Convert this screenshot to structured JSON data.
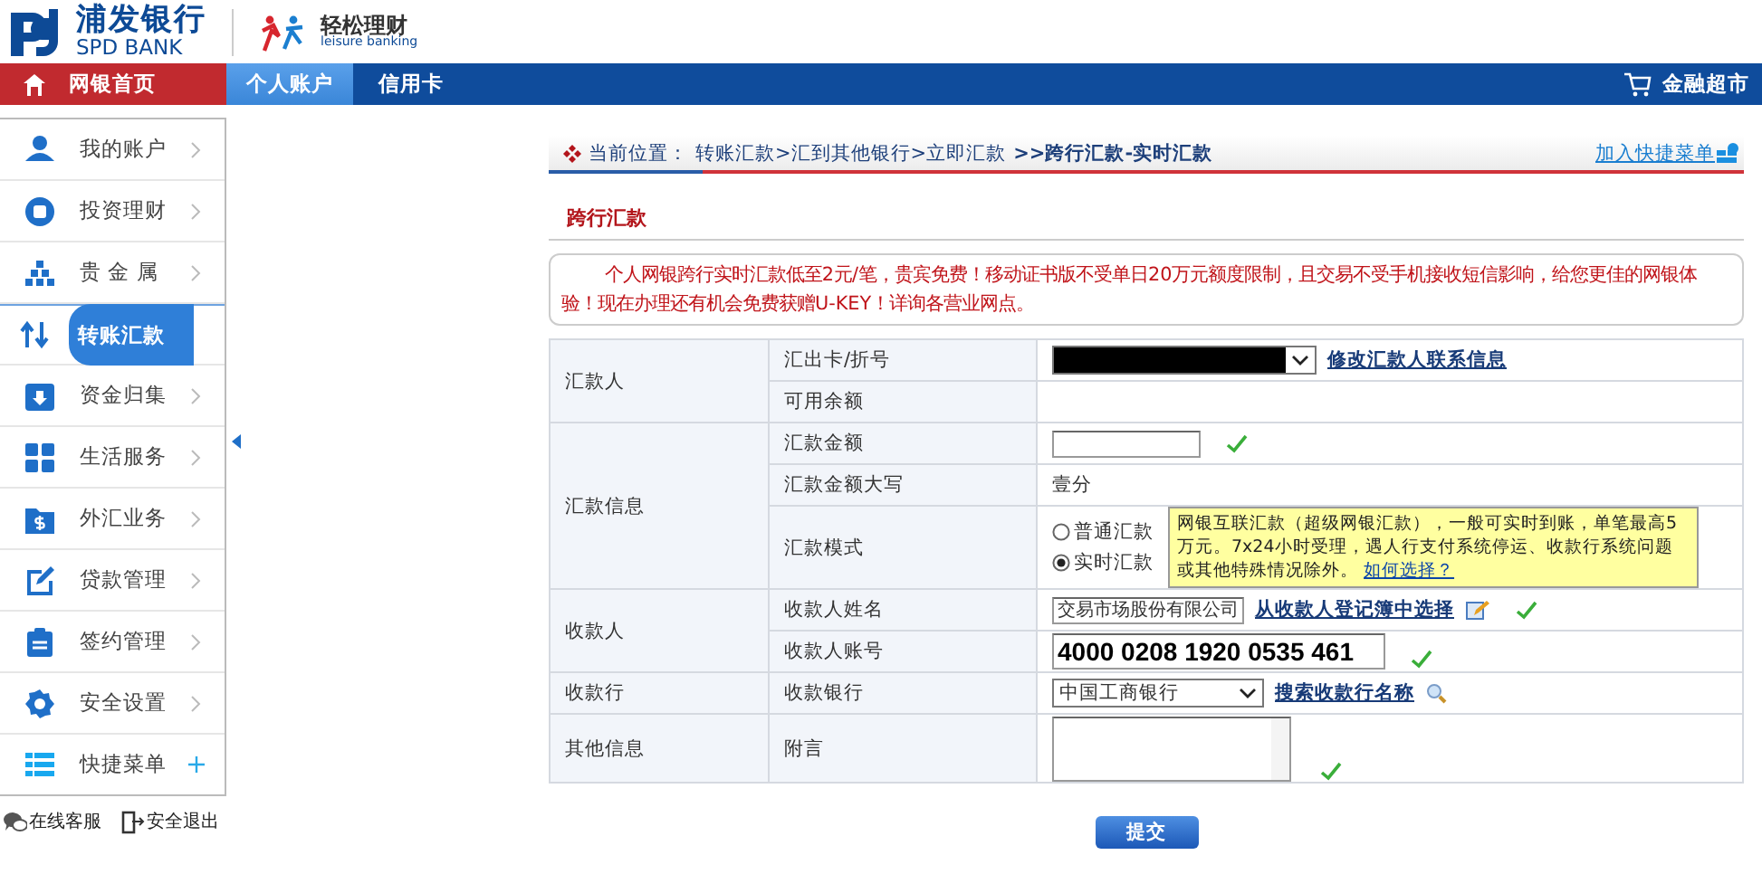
{
  "header": {
    "bank_name": "浦发银行",
    "bank_name_en": "SPD BANK",
    "brand": "轻松理财",
    "brand_en": "leisure banking"
  },
  "nav": {
    "home": "网银首页",
    "tabs": [
      {
        "label": "个人账户",
        "selected": true
      },
      {
        "label": "信用卡",
        "selected": false
      }
    ],
    "market": "金融超市"
  },
  "sidebar": {
    "items": [
      {
        "label": "我的账户",
        "kind": "submenu",
        "selected": false
      },
      {
        "label": "投资理财",
        "kind": "submenu",
        "selected": false
      },
      {
        "label": "贵 金 属",
        "kind": "submenu",
        "selected": false
      },
      {
        "label": "转账汇款",
        "selected": true
      },
      {
        "label": "资金归集",
        "kind": "submenu",
        "selected": false
      },
      {
        "label": "生活服务",
        "kind": "submenu",
        "selected": false
      },
      {
        "label": "外汇业务",
        "kind": "submenu",
        "selected": false
      },
      {
        "label": "贷款管理",
        "kind": "submenu",
        "selected": false
      },
      {
        "label": "签约管理",
        "kind": "submenu",
        "selected": false
      },
      {
        "label": "安全设置",
        "kind": "submenu",
        "selected": false
      },
      {
        "label": "快捷菜单",
        "kind": "add",
        "selected": false
      }
    ],
    "footer": [
      "在线客服",
      "安全退出"
    ]
  },
  "breadcrumb": {
    "label": "当前位置：",
    "trail": "转账汇款>汇到其他银行>立即汇款",
    "current": ">>跨行汇款-实时汇款",
    "shortcut": "加入快捷菜单"
  },
  "section_title": "跨行汇款",
  "notice": "个人网银跨行实时汇款低至2元/笔，贵宾免费！移动证书版不受单日20万元额度限制，且交易不受手机接收短信影响，给您更佳的网银体验！现在办理还有机会免费获赠U-KEY！详询各营业网点。",
  "form": [
    {
      "label": "汇款人",
      "rows": [
        {
          "label": "汇出卡/折号",
          "kind": "select",
          "redacted": true,
          "link": "修改汇款人联系信息"
        },
        {
          "label": "可用余额",
          "kind": "blank"
        }
      ]
    },
    {
      "label": "汇款信息",
      "rows": [
        {
          "label": "汇款金额",
          "kind": "input",
          "valid": true
        },
        {
          "label": "汇款金额大写",
          "kind": "static",
          "value": "壹分"
        },
        {
          "label": "汇款模式",
          "kind": "radio",
          "options": [
            {
              "label": "普通汇款",
              "selected": false
            },
            {
              "label": "实时汇款",
              "selected": true
            }
          ],
          "tip": "网银互联汇款（超级网银汇款），一般可实时到账，单笔最高5万元。7x24小时受理，遇人行支付系统停运、收款行系统问题或其他特殊情况除外。",
          "tip_link": "如何选择？"
        }
      ]
    },
    {
      "label": "收款人",
      "rows": [
        {
          "label": "收款人姓名",
          "kind": "input",
          "value": "交易市场股份有限公司",
          "link": "从收款人登记簿中选择",
          "valid": true
        },
        {
          "label": "收款人账号",
          "kind": "input-large",
          "value": "4000 0208 1920 0535 461",
          "valid": true
        }
      ]
    },
    {
      "label": "收款行",
      "rows": [
        {
          "label": "收款银行",
          "kind": "select",
          "value": "中国工商银行",
          "link": "搜索收款行名称"
        }
      ]
    },
    {
      "label": "其他信息",
      "rows": [
        {
          "label": "附言",
          "kind": "textarea",
          "valid": true
        }
      ]
    }
  ],
  "submit": "提交"
}
